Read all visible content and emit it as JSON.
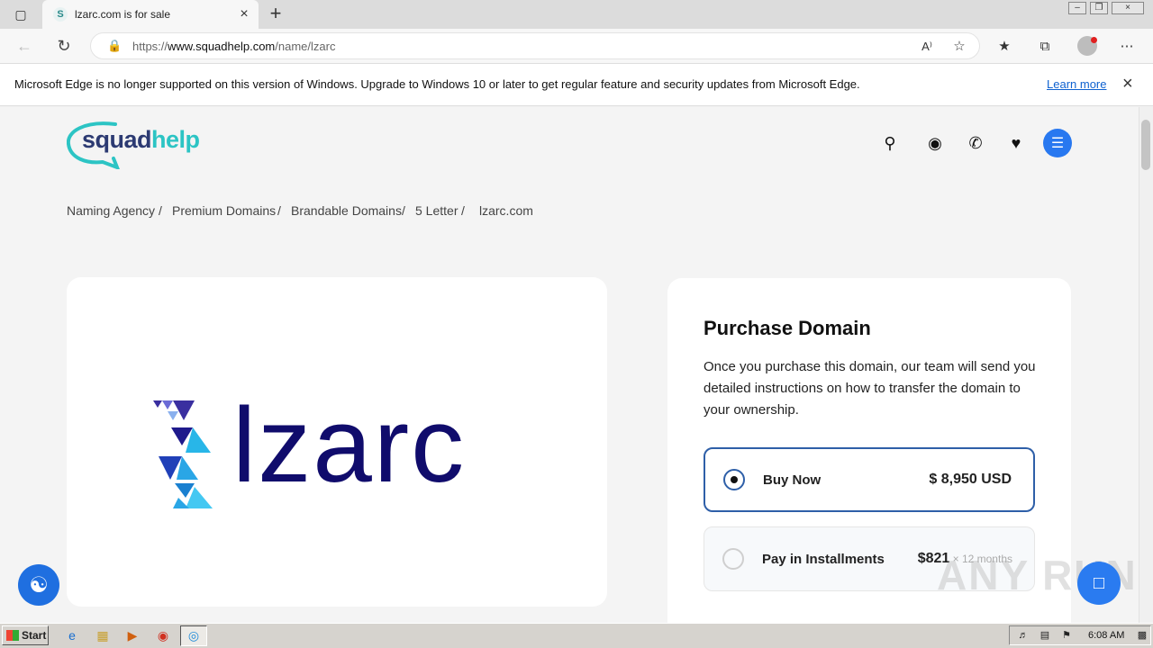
{
  "browser": {
    "tab_title": "lzarc.com is for sale",
    "tab_favicon": "S",
    "url_prefix": "https://",
    "url_host": "www.squadhelp.com",
    "url_path": "/name/lzarc",
    "infobar_text": "Microsoft Edge is no longer supported on this version of Windows. Upgrade to Windows 10 or later to get regular feature and security updates from Microsoft Edge.",
    "infobar_link": "Learn more"
  },
  "site": {
    "logo_part1": "squad",
    "logo_part2": "help",
    "brand_navy": "#2c3a72",
    "brand_teal": "#2cc4c4",
    "accent_blue": "#2878f0"
  },
  "breadcrumb": [
    {
      "label": "Naming Agency",
      "sep": "/"
    },
    {
      "label": "Premium Domains",
      "sep": "/"
    },
    {
      "label": "Brandable Domains",
      "sep": "/"
    },
    {
      "label": "5 Letter",
      "sep": "/"
    },
    {
      "label": "lzarc.com",
      "sep": ""
    }
  ],
  "domain": {
    "logo_word": "lzarc"
  },
  "purchase": {
    "title": "Purchase Domain",
    "description": "Once you purchase this domain, our team will send you detailed instructions on how to transfer the domain to your ownership.",
    "options": [
      {
        "label": "Buy Now",
        "price": "$ 8,950 USD",
        "suffix": "",
        "selected": true
      },
      {
        "label": "Pay in Installments",
        "price": "$821",
        "suffix": " × 12 months",
        "selected": false
      }
    ]
  },
  "watermark": "ANY RUN",
  "taskbar": {
    "start_label": "Start",
    "clock": "6:08 AM"
  }
}
